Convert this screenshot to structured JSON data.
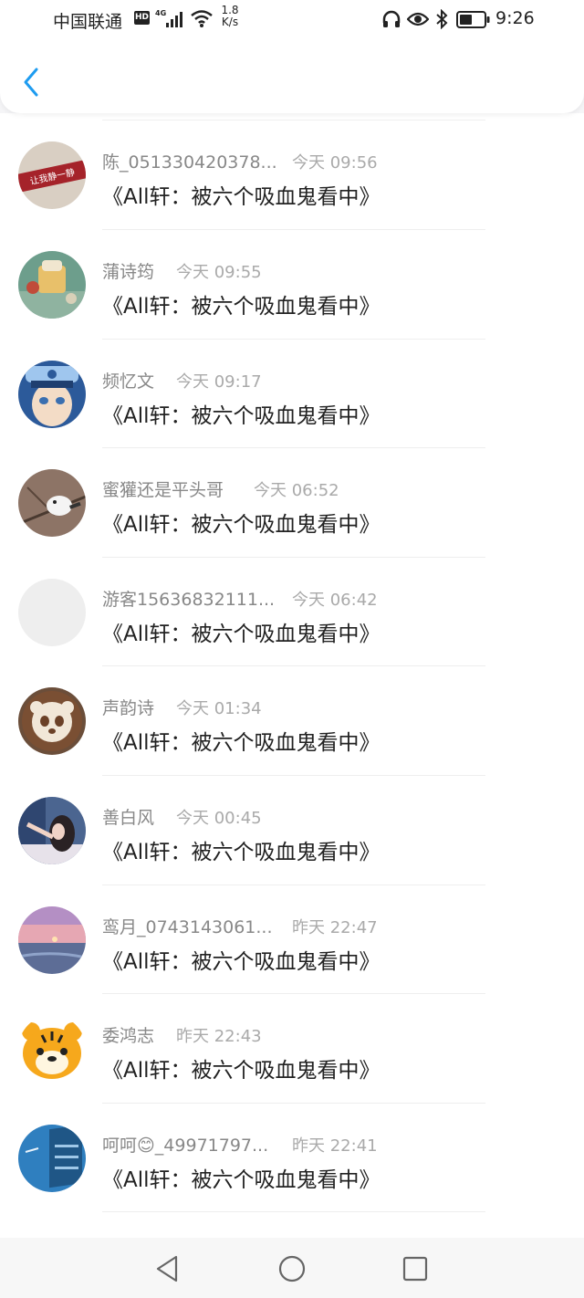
{
  "status_bar": {
    "carrier": "中国联通",
    "hd": "HD",
    "network": "4G",
    "speed_value": "1.8",
    "speed_unit": "K/s",
    "time": "9:26"
  },
  "list": {
    "items": [
      {
        "name": "陈_051330420378...",
        "time": "今天 09:56",
        "text": "《All轩：被六个吸血鬼看中》",
        "avatar_text": "让我静一静"
      },
      {
        "name": "蒲诗筠",
        "time": "今天 09:55",
        "text": "《All轩：被六个吸血鬼看中》"
      },
      {
        "name": "频忆文",
        "time": "今天 09:17",
        "text": "《All轩：被六个吸血鬼看中》"
      },
      {
        "name": "蜜獾还是平头哥",
        "time": "今天 06:52",
        "text": "《All轩：被六个吸血鬼看中》"
      },
      {
        "name": "游客15636832111...",
        "time": "今天 06:42",
        "text": "《All轩：被六个吸血鬼看中》"
      },
      {
        "name": "声韵诗",
        "time": "今天 01:34",
        "text": "《All轩：被六个吸血鬼看中》"
      },
      {
        "name": "善白风",
        "time": "今天 00:45",
        "text": "《All轩：被六个吸血鬼看中》"
      },
      {
        "name": "鸾月_0743143061...",
        "time": "昨天 22:47",
        "text": "《All轩：被六个吸血鬼看中》"
      },
      {
        "name": "委鸿志",
        "time": "昨天 22:43",
        "text": "《All轩：被六个吸血鬼看中》"
      },
      {
        "name": "呵呵😊_49971797...",
        "time": "昨天 22:41",
        "text": "《All轩：被六个吸血鬼看中》"
      }
    ]
  },
  "colors": {
    "accent": "#1e9cf0",
    "name_gray": "#888888",
    "time_gray": "#aaaaaa",
    "text": "#222222"
  }
}
